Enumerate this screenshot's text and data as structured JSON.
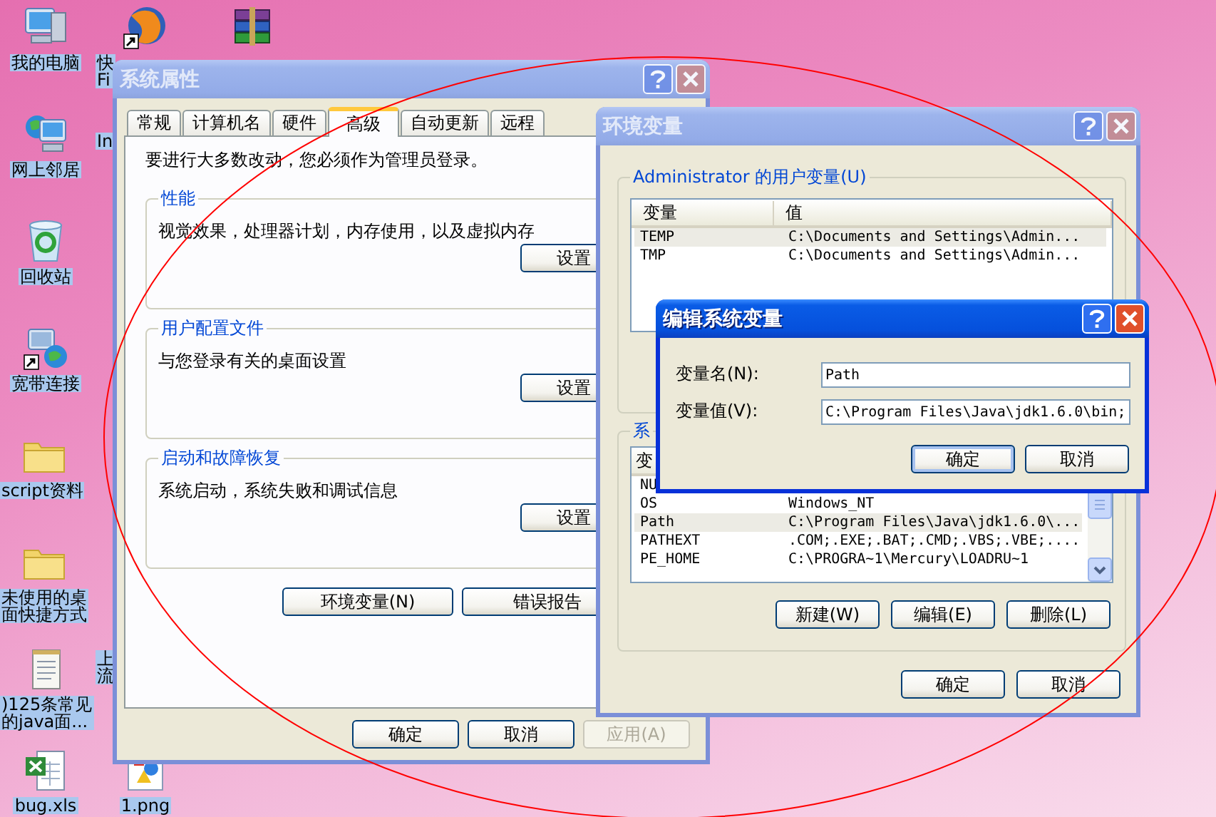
{
  "desktop_icons": [
    {
      "kind": "computer",
      "label_lines": [
        "我的电脑"
      ]
    },
    {
      "kind": "network",
      "label_lines": [
        "网上邻居"
      ]
    },
    {
      "kind": "recycle",
      "label_lines": [
        "回收站"
      ]
    },
    {
      "kind": "connection",
      "label_lines": [
        "宽带连接"
      ]
    },
    {
      "kind": "folder",
      "label_lines": [
        "script资料"
      ]
    },
    {
      "kind": "folder",
      "label_lines": [
        "未使用的桌",
        "面快捷方式"
      ]
    },
    {
      "kind": "notepad",
      "label_lines": [
        ")125条常见",
        "的java面..."
      ]
    },
    {
      "kind": "spreadsheet",
      "label_lines": [
        "bug.xls"
      ]
    },
    {
      "kind": "globe",
      "label_lines": [
        "快",
        "Fi"
      ]
    },
    {
      "kind": "covered",
      "label_lines": [
        "In"
      ]
    },
    {
      "kind": "covered",
      "label_lines": [
        "上",
        "流"
      ]
    },
    {
      "kind": "image",
      "label_lines": [
        "1.png"
      ]
    },
    {
      "kind": "archive"
    }
  ],
  "system_properties": {
    "title": "系统属性",
    "tabs": [
      {
        "label": "常规",
        "selected": false
      },
      {
        "label": "计算机名",
        "selected": false
      },
      {
        "label": "硬件",
        "selected": false
      },
      {
        "label": "高级",
        "selected": true
      },
      {
        "label": "自动更新",
        "selected": false
      },
      {
        "label": "远程",
        "selected": false
      }
    ],
    "intro": "要进行大多数改动，您必须作为管理员登录。",
    "groups": [
      {
        "title": "性能",
        "description": "视觉效果，处理器计划，内存使用，以及虚拟内存",
        "button": "设置"
      },
      {
        "title": "用户配置文件",
        "description": "与您登录有关的桌面设置",
        "button": "设置"
      },
      {
        "title": "启动和故障恢复",
        "description": "系统启动，系统失败和调试信息",
        "button": "设置"
      }
    ],
    "extra_buttons": [
      "环境变量(N)",
      "错误报告"
    ],
    "buttons": [
      {
        "label": "确定",
        "disabled": false
      },
      {
        "label": "取消",
        "disabled": false
      },
      {
        "label": "应用(A)",
        "disabled": true
      }
    ]
  },
  "environment_variables": {
    "title": "环境变量",
    "user_group": {
      "title": "Administrator 的用户变量(U)",
      "columns": [
        "变量",
        "值"
      ],
      "rows": [
        {
          "name": "TEMP",
          "value": "C:\\Documents and Settings\\Admin...",
          "selected": true
        },
        {
          "name": "TMP",
          "value": "C:\\Documents and Settings\\Admin...",
          "selected": false
        }
      ]
    },
    "system_group": {
      "title": "系",
      "columns": [
        "变"
      ],
      "rows": [
        {
          "name": "NU",
          "selected": false
        },
        {
          "name": "OS",
          "value": "Windows_NT",
          "selected": false
        },
        {
          "name": "Path",
          "value": "C:\\Program Files\\Java\\jdk1.6.0\\...",
          "selected": true
        },
        {
          "name": "PATHEXT",
          "value": ".COM;.EXE;.BAT;.CMD;.VBS;.VBE;....",
          "selected": false
        },
        {
          "name": "PE_HOME",
          "value": "C:\\PROGRA~1\\Mercury\\LOADRU~1",
          "selected": false
        }
      ],
      "buttons": [
        "新建(W)",
        "编辑(E)",
        "删除(L)"
      ]
    },
    "buttons": [
      "确定",
      "取消"
    ]
  },
  "edit_dialog": {
    "title": "编辑系统变量",
    "fields": [
      {
        "label": "变量名(N):",
        "value": "Path"
      },
      {
        "label": "变量值(V):",
        "value": "C:\\Program Files\\Java\\jdk1.6.0\\bin;"
      }
    ],
    "buttons": [
      {
        "label": "确定",
        "default": true
      },
      {
        "label": "取消",
        "default": false
      }
    ]
  }
}
